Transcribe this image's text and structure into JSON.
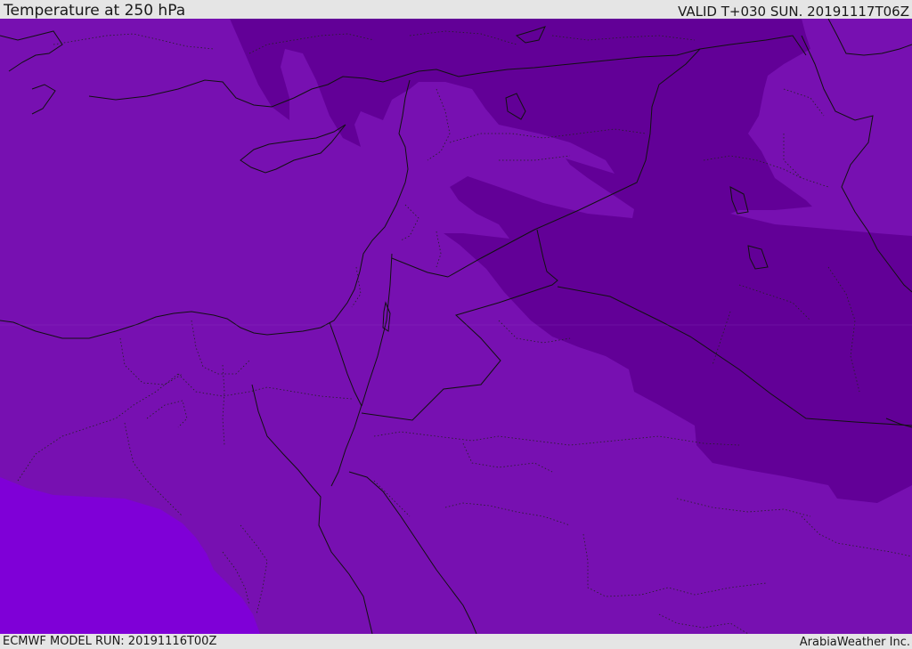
{
  "header": {
    "title": "Temperature at 250 hPa",
    "valid_time": "VALID T+030 SUN. 20191117T06Z"
  },
  "footer": {
    "model_run": "ECMWF MODEL RUN: 20191116T00Z",
    "credit": "ArabiaWeather Inc."
  },
  "colors": {
    "base_field": "#7710b1",
    "cold_field": "#620097",
    "warm_field": "#7f00d7",
    "borders": "#111111"
  }
}
